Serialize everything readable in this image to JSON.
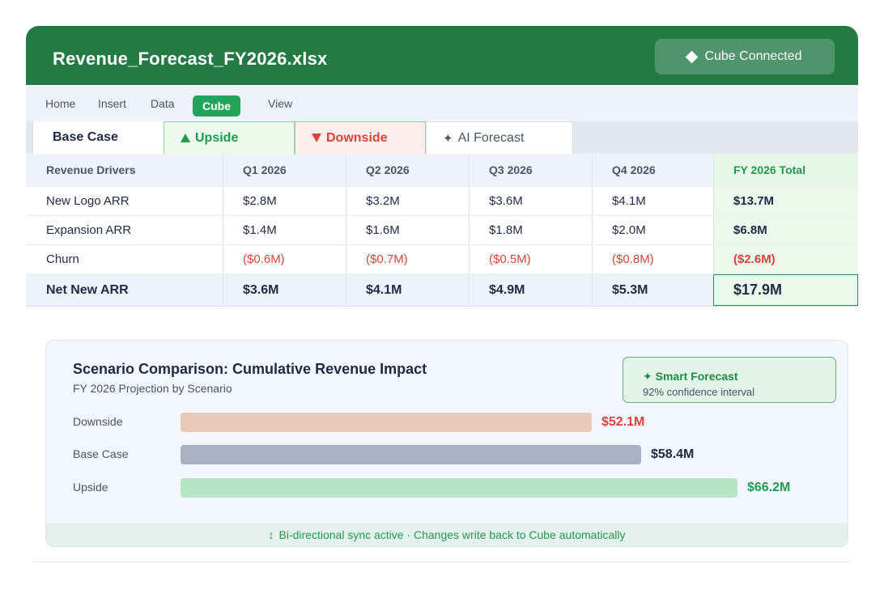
{
  "window": {
    "file_title": "Revenue_Forecast_FY2026.xlsx",
    "connection_label": "Cube Connected"
  },
  "menu": {
    "items": [
      "Home",
      "Insert",
      "Data",
      "Cube",
      "View"
    ],
    "active": "Cube"
  },
  "tabs": [
    {
      "label": "Base Case",
      "icon": "none"
    },
    {
      "label": "Upside",
      "icon": "triangle-up-icon"
    },
    {
      "label": "Downside",
      "icon": "triangle-down-icon"
    },
    {
      "label": "AI Forecast",
      "icon": "sparkle-icon"
    }
  ],
  "table": {
    "columns": [
      "Revenue Drivers",
      "Q1 2026",
      "Q2 2026",
      "Q3 2026",
      "Q4 2026",
      "FY 2026 Total"
    ],
    "rows": [
      {
        "label": "New Logo ARR",
        "values": [
          "$2.8M",
          "$3.2M",
          "$3.6M",
          "$4.1M",
          "$13.7M"
        ]
      },
      {
        "label": "Expansion ARR",
        "values": [
          "$1.4M",
          "$1.6M",
          "$1.8M",
          "$2.0M",
          "$6.8M"
        ]
      },
      {
        "label": "Churn",
        "values": [
          "($0.6M)",
          "($0.7M)",
          "($0.5M)",
          "($0.8M)",
          "($2.6M)"
        ]
      }
    ],
    "total": {
      "label": "Net New ARR",
      "values": [
        "$3.6M",
        "$4.1M",
        "$4.9M",
        "$5.3M",
        "$17.9M"
      ]
    }
  },
  "chart_card": {
    "title": "Scenario Comparison: Cumulative Revenue Impact",
    "subtitle": "FY 2026 Projection by Scenario",
    "smart_forecast": {
      "title": "✦ Smart Forecast",
      "subtitle": "92% confidence interval"
    },
    "sync_text": "Bi-directional sync active · Changes write back to Cube automatically"
  },
  "chart_data": {
    "type": "bar",
    "orientation": "horizontal",
    "categories": [
      "Downside",
      "Base Case",
      "Upside"
    ],
    "values": [
      52.1,
      58.4,
      66.2
    ],
    "value_labels": [
      "$52.1M",
      "$58.4M",
      "$66.2M"
    ],
    "title": "Scenario Comparison: Cumulative Revenue Impact",
    "subtitle": "FY 2026 Projection by Scenario",
    "xlabel": "",
    "ylabel": "",
    "colors": [
      "#e8c9b8",
      "#a9b1c2",
      "#b8e6c4"
    ],
    "label_colors": [
      "#d8453b",
      "#1f2a44",
      "#1f9b4f"
    ]
  },
  "colors": {
    "brand_green": "#237a45",
    "accent_green": "#22a55b",
    "negative_red": "#d8453b"
  }
}
